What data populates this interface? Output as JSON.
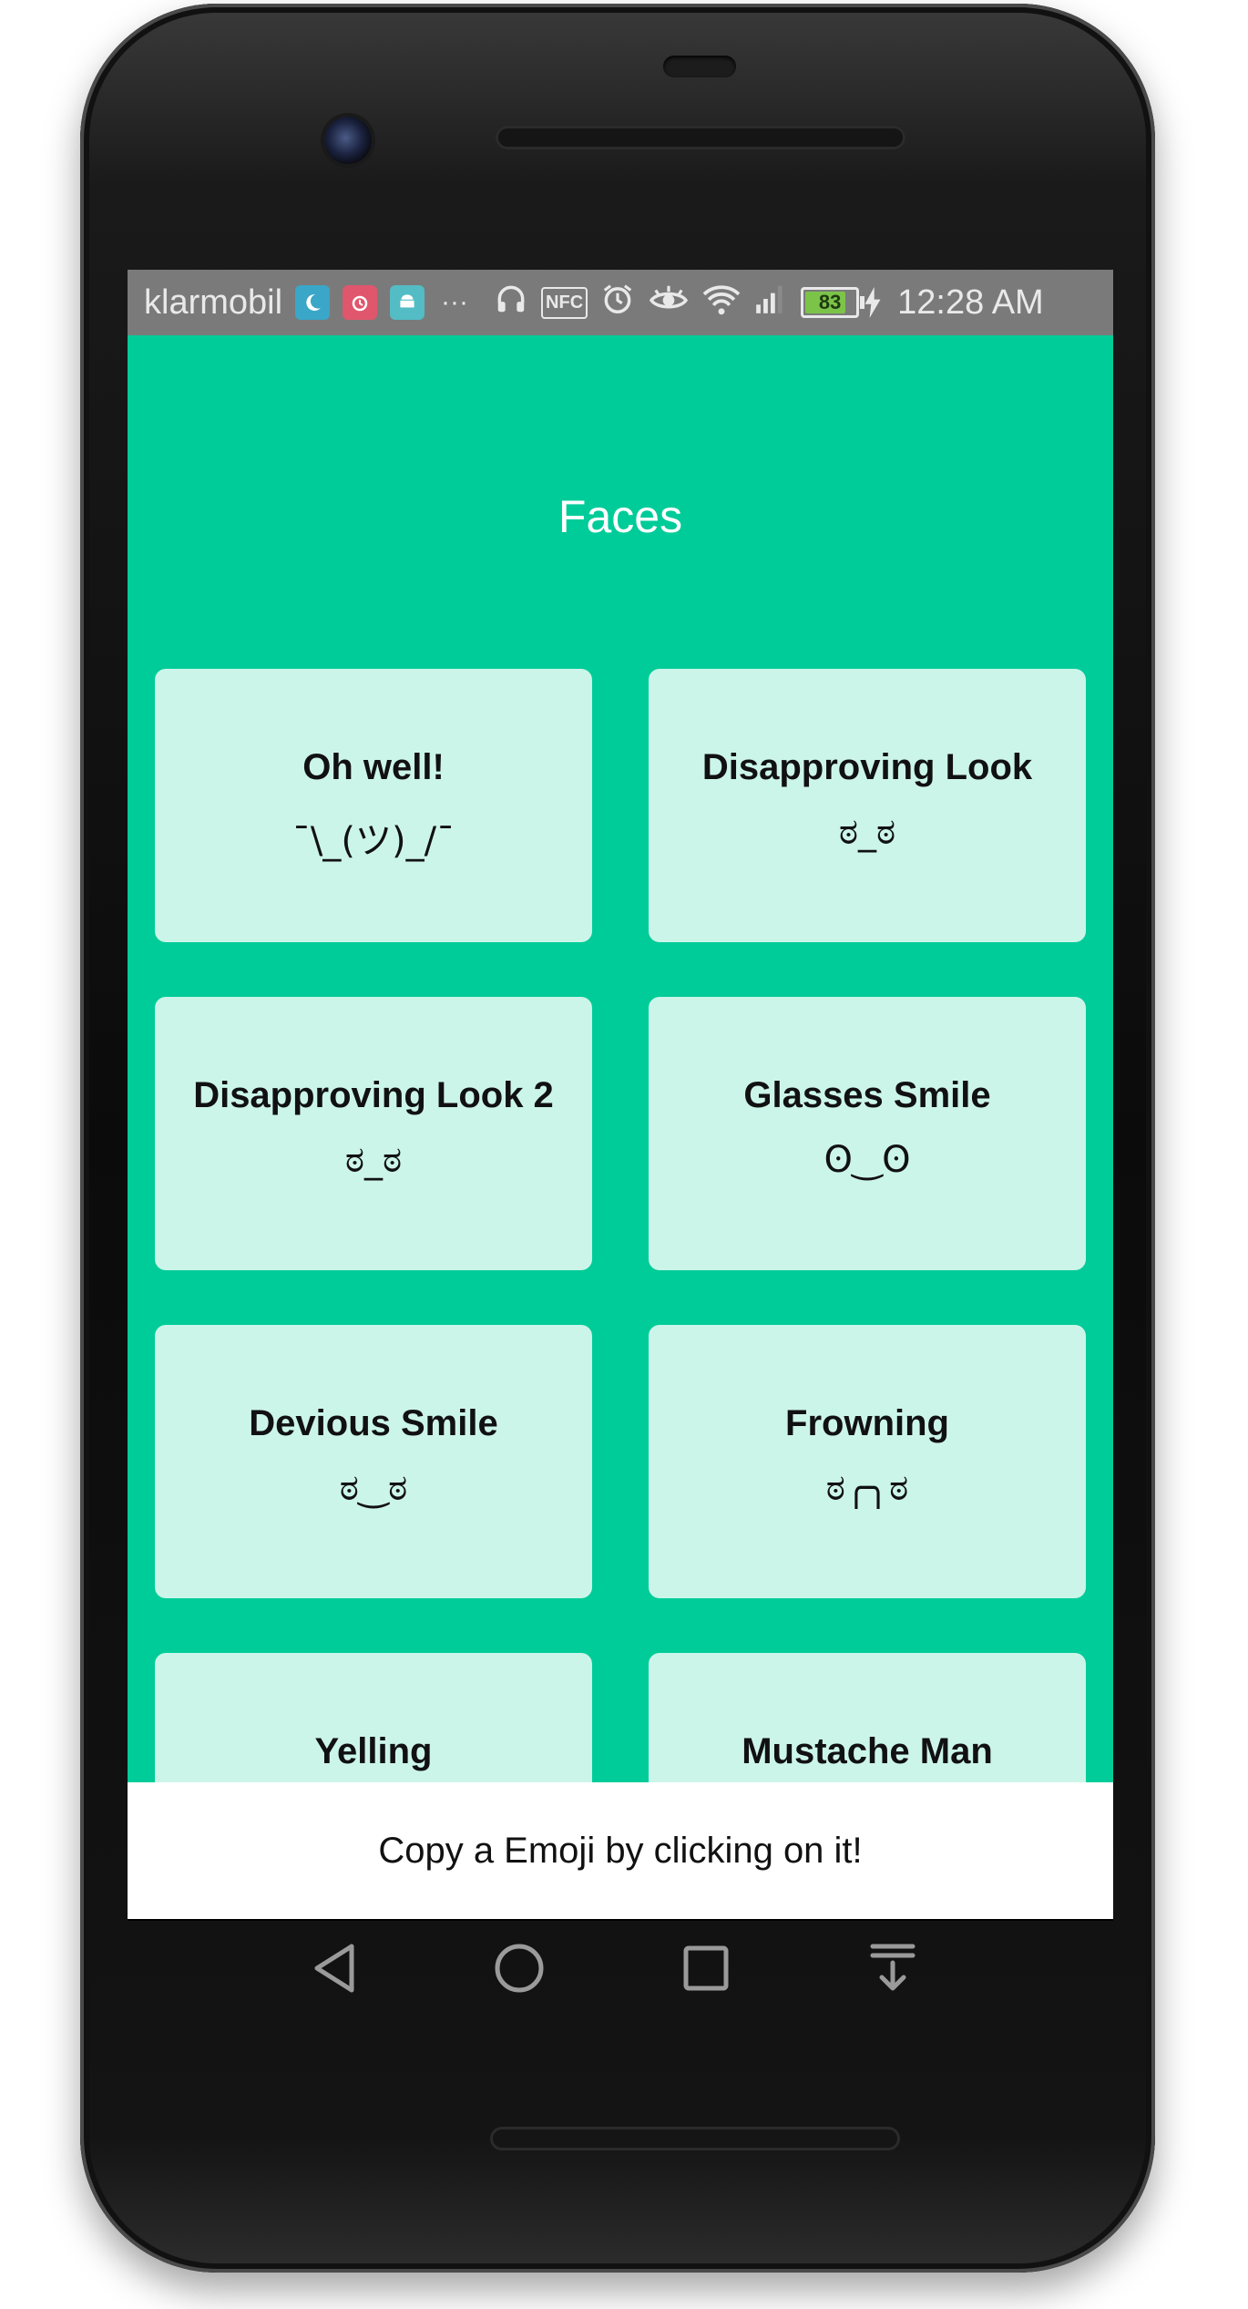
{
  "status_bar": {
    "carrier": "klarmobil",
    "notification_icons": [
      "moon-icon",
      "alarm-app-icon",
      "android-icon"
    ],
    "overflow": "···",
    "system_icons": [
      "headphones-icon",
      "nfc-icon",
      "alarm-clock-icon",
      "eye-icon",
      "wifi-icon",
      "signal-icon"
    ],
    "nfc_label": "NFC",
    "battery_level": "83",
    "battery_fraction": 0.83,
    "time": "12:28 AM"
  },
  "app": {
    "title": "Faces",
    "background_color": "#00cc99",
    "card_color": "#ccf5e9",
    "cards": [
      {
        "title": "Oh well!",
        "face": "¯\\_(ツ)_/¯"
      },
      {
        "title": "Disapproving Look",
        "face": "ಠ_ಠ"
      },
      {
        "title": "Disapproving Look 2",
        "face": "ಠ_ಠ"
      },
      {
        "title": "Glasses Smile",
        "face": "ʘ‿ʘ"
      },
      {
        "title": "Devious Smile",
        "face": "ಠ‿ಠ"
      },
      {
        "title": "Frowning",
        "face": "ಠ╭╮ಠ"
      },
      {
        "title": "Yelling",
        "face": ""
      },
      {
        "title": "Mustache Man",
        "face": ""
      }
    ]
  },
  "toast": {
    "message": "Copy a Emoji by clicking on it!"
  },
  "nav_bar": {
    "buttons": [
      "back-icon",
      "home-icon",
      "recents-icon",
      "notification-shade-icon"
    ]
  }
}
